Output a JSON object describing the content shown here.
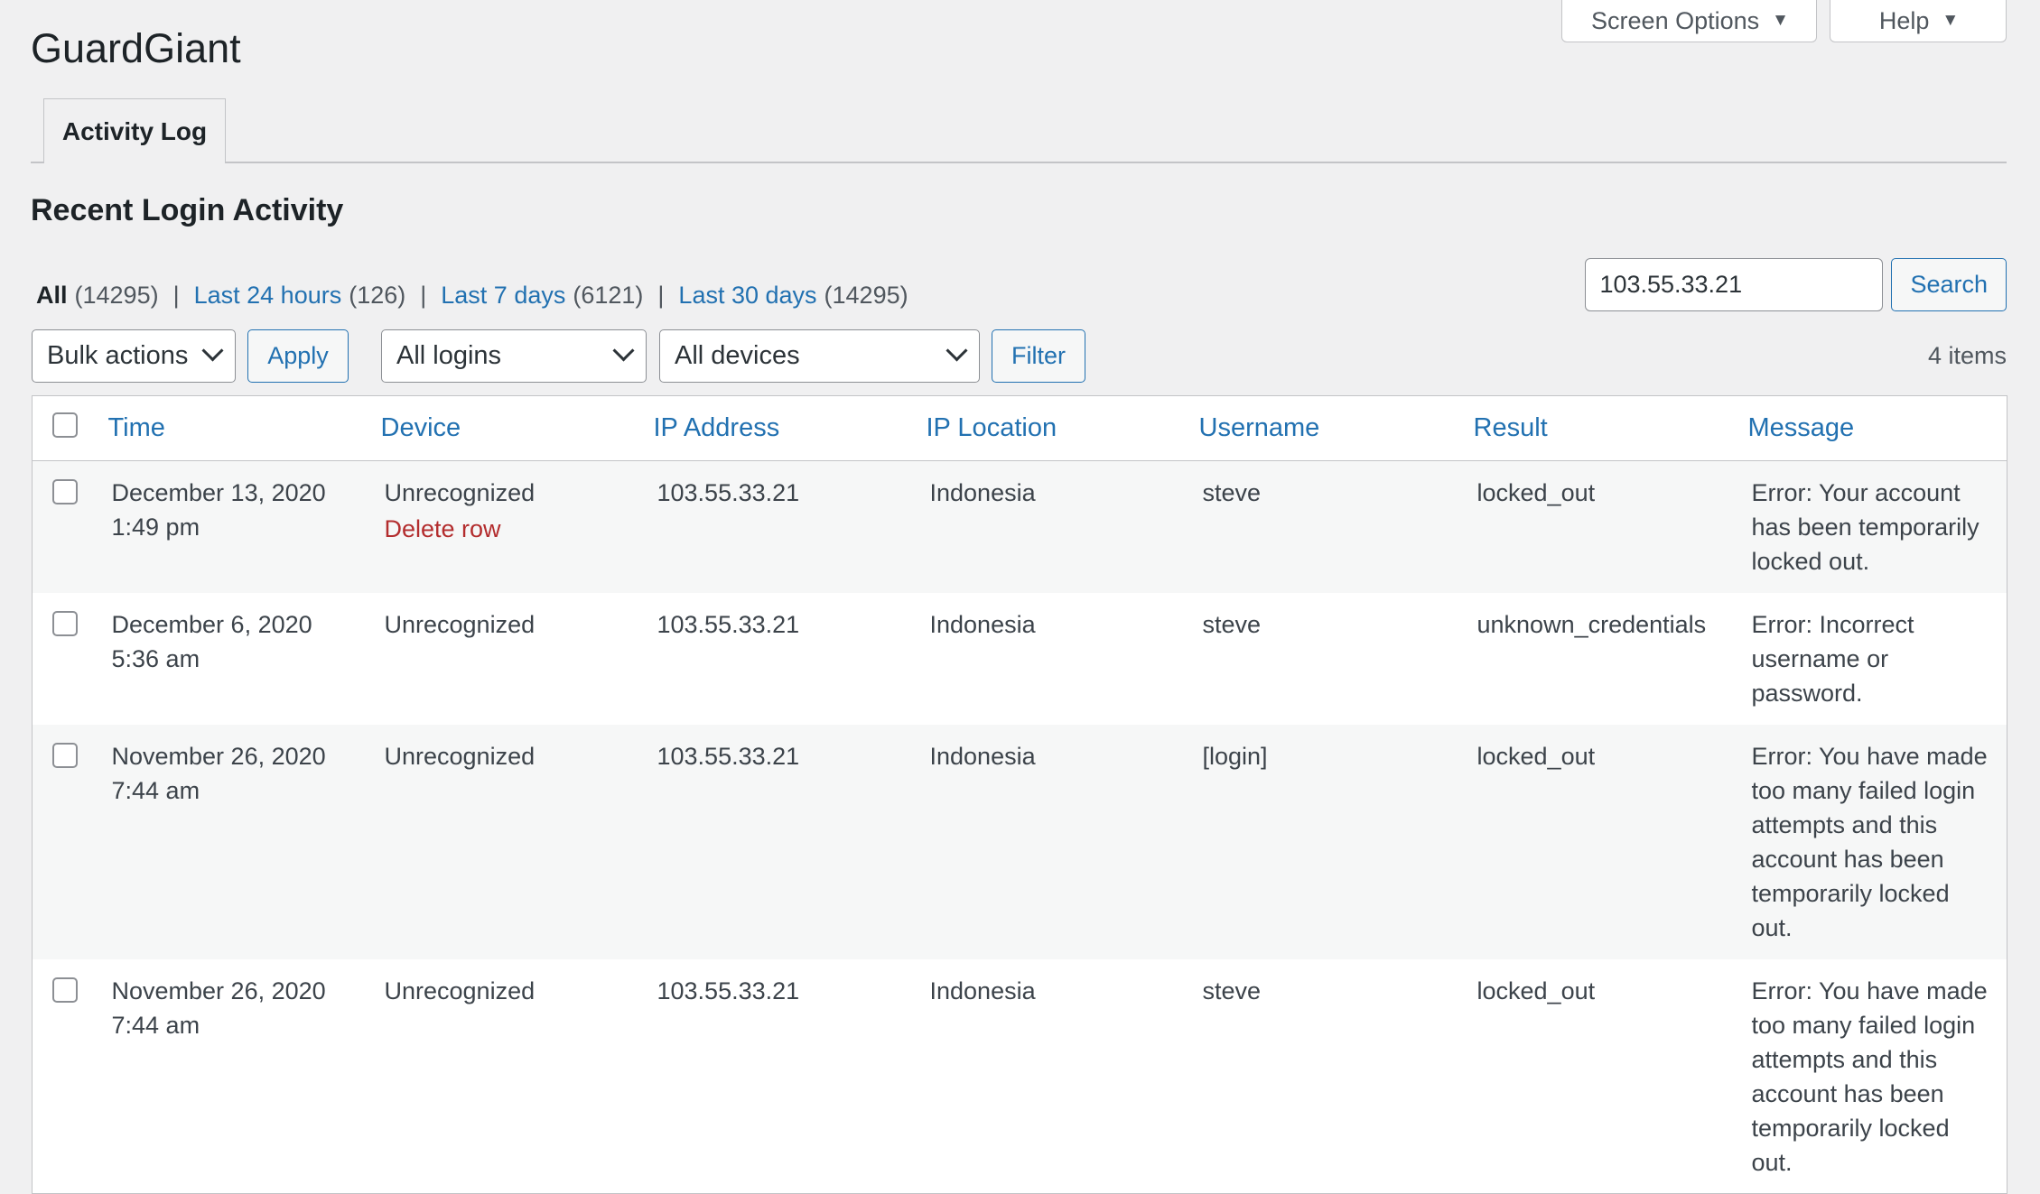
{
  "meta_links": {
    "screen_options": "Screen Options",
    "help": "Help"
  },
  "app": {
    "title": "GuardGiant"
  },
  "tabs": [
    {
      "label": "Activity Log"
    }
  ],
  "section": {
    "title": "Recent Login Activity"
  },
  "views": {
    "all": {
      "label": "All",
      "count": "(14295)"
    },
    "last24": {
      "label": "Last 24 hours",
      "count": "(126)"
    },
    "last7": {
      "label": "Last 7 days",
      "count": "(6121)"
    },
    "last30": {
      "label": "Last 30 days",
      "count": "(14295)"
    },
    "separator": "|"
  },
  "search": {
    "value": "103.55.33.21",
    "button": "Search"
  },
  "tablenav": {
    "bulk_actions": "Bulk actions",
    "apply": "Apply",
    "logins": "All logins",
    "devices": "All devices",
    "filter": "Filter",
    "items": "4 items"
  },
  "table": {
    "columns": [
      "Time",
      "Device",
      "IP Address",
      "IP Location",
      "Username",
      "Result",
      "Message"
    ],
    "rows": [
      {
        "date": "December 13, 2020",
        "time": "1:49 pm",
        "device": "Unrecognized",
        "row_action": "Delete row",
        "ip": "103.55.33.21",
        "location": "Indonesia",
        "username": "steve",
        "result": "locked_out",
        "message": "Error: Your account has been temporarily locked out."
      },
      {
        "date": "December 6, 2020",
        "time": "5:36 am",
        "device": "Unrecognized",
        "ip": "103.55.33.21",
        "location": "Indonesia",
        "username": "steve",
        "result": "unknown_credentials",
        "message": "Error: Incorrect username or password."
      },
      {
        "date": "November 26, 2020",
        "time": "7:44 am",
        "device": "Unrecognized",
        "ip": "103.55.33.21",
        "location": "Indonesia",
        "username": "[login]",
        "result": "locked_out",
        "message": "Error: You have made too many failed login attempts and this account has been temporarily locked out."
      },
      {
        "date": "November 26, 2020",
        "time": "7:44 am",
        "device": "Unrecognized",
        "ip": "103.55.33.21",
        "location": "Indonesia",
        "username": "steve",
        "result": "locked_out",
        "message": "Error: You have made too many failed login attempts and this account has been temporarily locked out."
      }
    ]
  }
}
